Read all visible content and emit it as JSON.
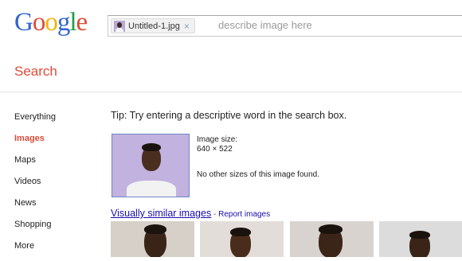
{
  "logo": {
    "letters": [
      "G",
      "o",
      "o",
      "g",
      "l",
      "e"
    ],
    "colors": [
      "#3366cc",
      "#dd4b39",
      "#f5b400",
      "#3366cc",
      "#1f9e43",
      "#dd4b39"
    ]
  },
  "search": {
    "chip_filename": "Untitled-1.jpg",
    "chip_close": "×",
    "placeholder": "describe image here"
  },
  "subbar": {
    "title": "Search"
  },
  "nav": {
    "items": [
      {
        "label": "Everything",
        "active": false
      },
      {
        "label": "Images",
        "active": true
      },
      {
        "label": "Maps",
        "active": false
      },
      {
        "label": "Videos",
        "active": false
      },
      {
        "label": "News",
        "active": false
      },
      {
        "label": "Shopping",
        "active": false
      },
      {
        "label": "More",
        "active": false
      }
    ]
  },
  "tip": "Tip: Try entering a descriptive word in the search box.",
  "image_info": {
    "size_label": "Image size:",
    "size_value": "640 × 522",
    "no_sizes": "No other sizes of this image found."
  },
  "similar": {
    "link_label": "Visually similar images",
    "separator": " - ",
    "report_label": "Report images"
  },
  "colors": {
    "accent_red": "#dd4b39",
    "link_blue": "#1a0dab"
  }
}
